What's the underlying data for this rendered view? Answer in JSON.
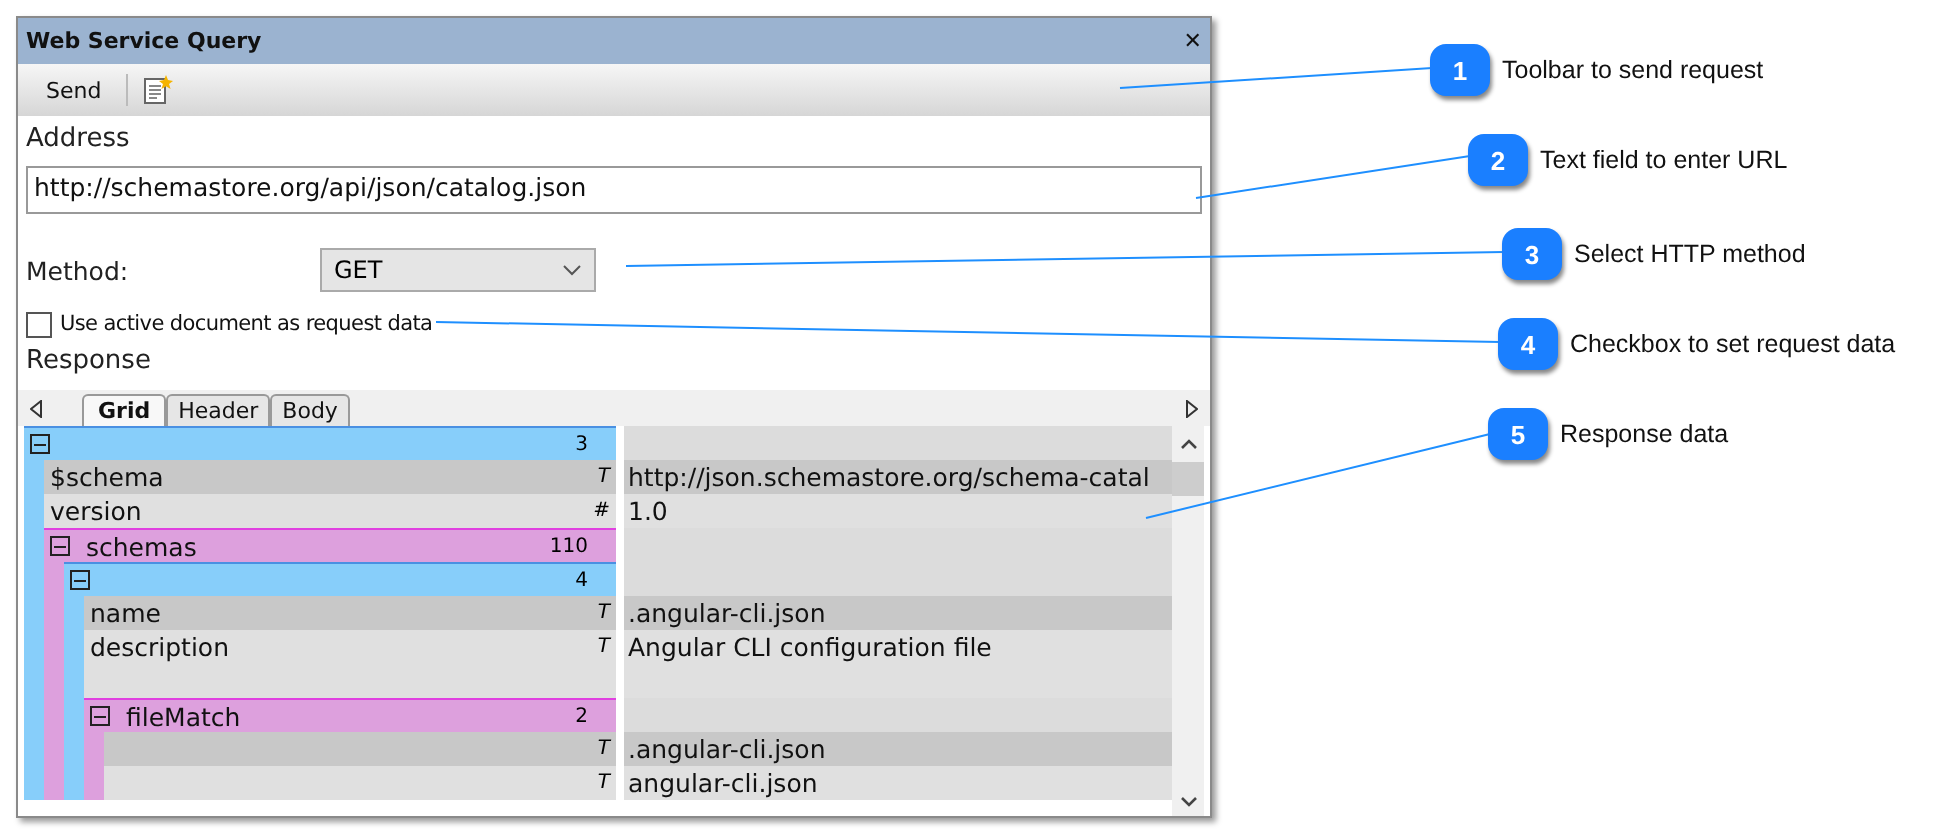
{
  "window": {
    "title": "Web Service Query",
    "close": "✕"
  },
  "toolbar": {
    "send_button": "Send"
  },
  "address": {
    "label": "Address",
    "value": "http://schemastore.org/api/json/catalog.json"
  },
  "method": {
    "label": "Method:",
    "value": "GET"
  },
  "request_data_checkbox": {
    "label": "Use active document as request data",
    "checked": false
  },
  "response": {
    "label": "Response",
    "tabs": [
      {
        "label": "Grid",
        "selected": true
      },
      {
        "label": "Header",
        "selected": false
      },
      {
        "label": "Body",
        "selected": false
      }
    ],
    "grid": {
      "kind": "group",
      "count": "3",
      "color": "#87cefa",
      "expanded": true,
      "children": [
        {
          "kind": "field",
          "name": "$schema",
          "type": "T",
          "value": "http://json.schemastore.org/schema-catal"
        },
        {
          "kind": "field",
          "name": "version",
          "type": "#",
          "value": "1.0"
        },
        {
          "kind": "group",
          "name": "schemas",
          "count": "110",
          "color": "#dda0dd",
          "expanded": true,
          "children": [
            {
              "kind": "group",
              "count": "4",
              "color": "#87cefa",
              "expanded": true,
              "children": [
                {
                  "kind": "field",
                  "name": "name",
                  "type": "T",
                  "value": ".angular-cli.json"
                },
                {
                  "kind": "field",
                  "name": "description",
                  "type": "T",
                  "value": "Angular CLI configuration file",
                  "tall": true
                },
                {
                  "kind": "group",
                  "name": "fileMatch",
                  "count": "2",
                  "color": "#dda0dd",
                  "expanded": true,
                  "children": [
                    {
                      "kind": "field",
                      "type": "T",
                      "value": ".angular-cli.json"
                    },
                    {
                      "kind": "field",
                      "type": "T",
                      "value": "angular-cli.json"
                    }
                  ]
                }
              ]
            }
          ]
        }
      ]
    }
  },
  "annotations": [
    {
      "number": "1",
      "text": "Toolbar to send request"
    },
    {
      "number": "2",
      "text": "Text field to enter URL"
    },
    {
      "number": "3",
      "text": "Select HTTP method"
    },
    {
      "number": "4",
      "text": "Checkbox to set request data"
    },
    {
      "number": "5",
      "text": "Response data"
    }
  ]
}
